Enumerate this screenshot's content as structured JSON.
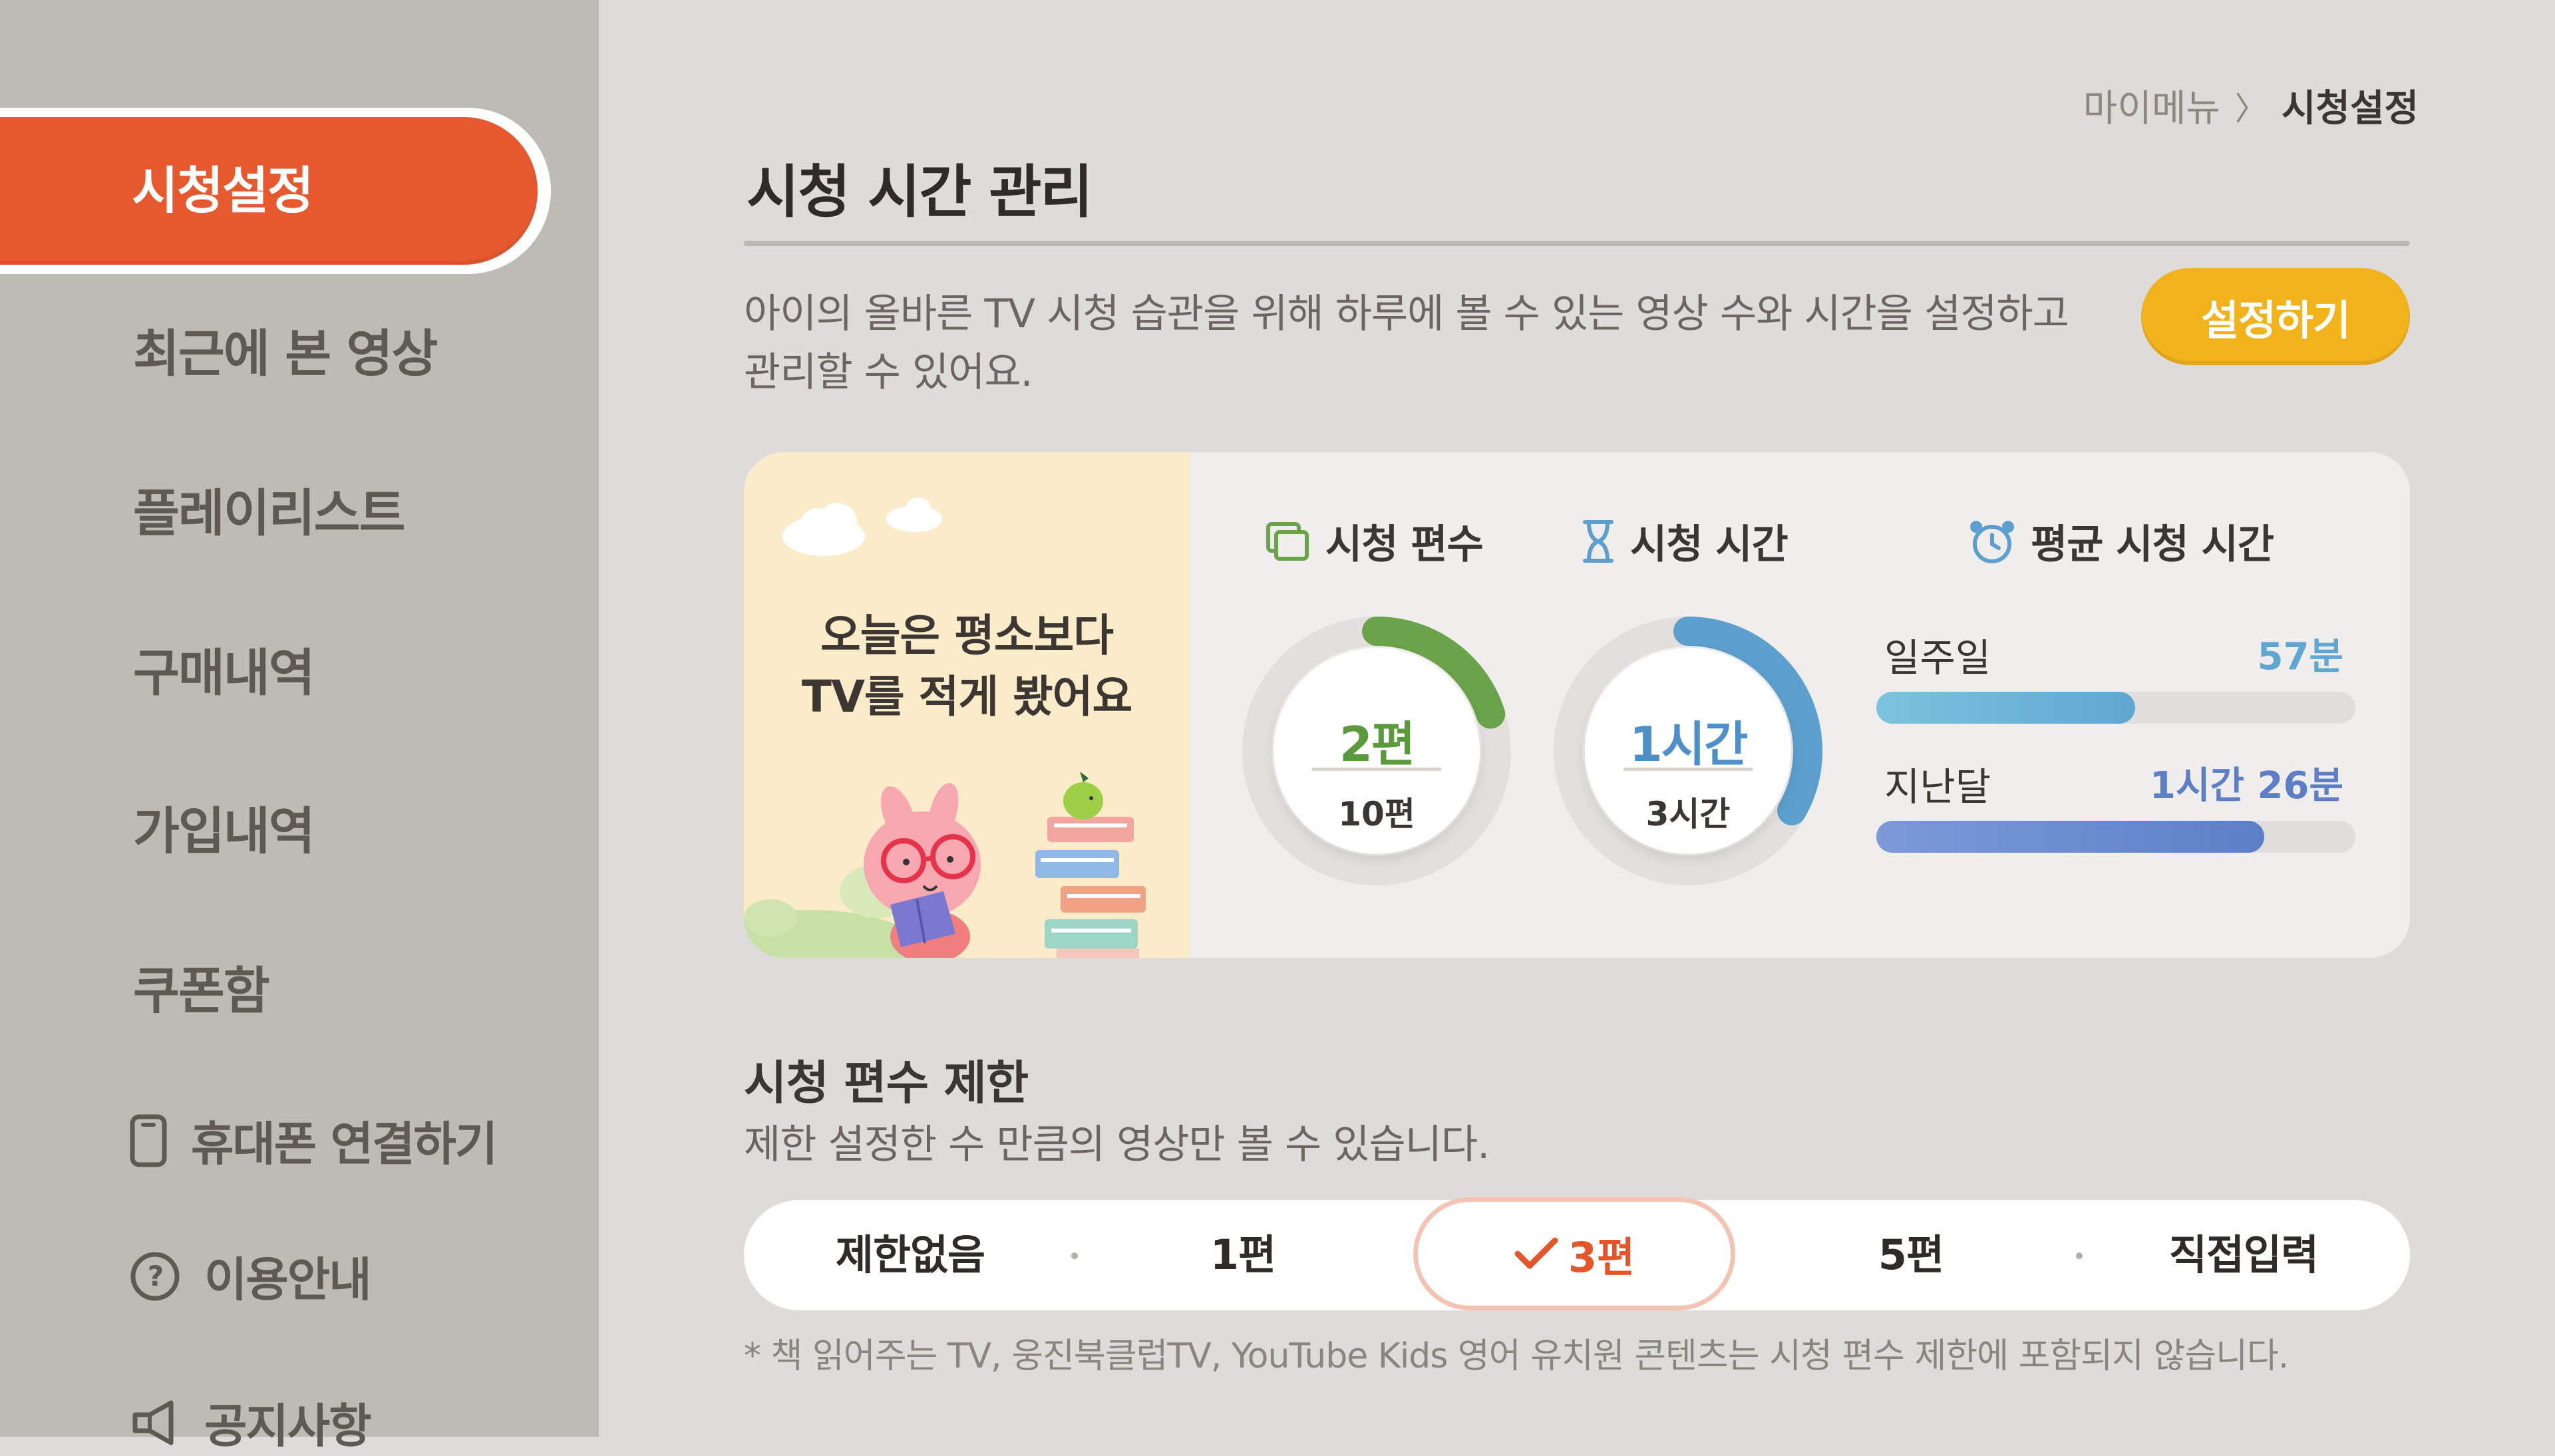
{
  "sidebar": {
    "items": [
      {
        "label": "시청설정",
        "active": true
      },
      {
        "label": "최근에 본 영상"
      },
      {
        "label": "플레이리스트"
      },
      {
        "label": "구매내역"
      },
      {
        "label": "가입내역"
      },
      {
        "label": "쿠폰함"
      }
    ],
    "sub_items": [
      {
        "label": "휴대폰 연결하기",
        "icon": "phone-icon"
      },
      {
        "label": "이용안내",
        "icon": "help-icon"
      },
      {
        "label": "공지사항",
        "icon": "megaphone-icon"
      }
    ]
  },
  "breadcrumb": {
    "parent": "마이메뉴",
    "separator": "〉",
    "current": "시청설정"
  },
  "header": {
    "title": "시청 시간 관리",
    "description_line1": "아이의 올바른 TV 시청 습관을 위해 하루에 볼 수 있는 영상 수와 시간을 설정하고",
    "description_line2": "관리할 수 있어요.",
    "setup_button": "설정하기"
  },
  "summary": {
    "message_line1": "오늘은 평소보다",
    "message_line2": "TV를 적게 봤어요",
    "episodes": {
      "label": "시청 편수",
      "icon": "episodes-icon",
      "watched": "2편",
      "limit": "10편",
      "progress": 0.2
    },
    "time": {
      "label": "시청 시간",
      "icon": "hourglass-icon",
      "watched": "1시간",
      "limit": "3시간",
      "progress": 0.333
    },
    "average": {
      "label": "평균 시청 시간",
      "icon": "alarm-clock-icon",
      "week_label": "일주일",
      "week_value": "57분",
      "week_fraction": 0.54,
      "month_label": "지난달",
      "month_value": "1시간 26분",
      "month_fraction": 0.81
    }
  },
  "limit": {
    "title": "시청 편수 제한",
    "description": "제한 설정한 수 만큼의 영상만 볼 수 있습니다.",
    "options": [
      "제한없음",
      "1편",
      "3편",
      "5편",
      "직접입력"
    ],
    "selected": "3편",
    "footnote": "* 책 읽어주는 TV, 웅진북클럽TV, YouTube Kids 영어 유치원 콘텐츠는 시청 편수 제한에 포함되지 않습니다."
  },
  "colors": {
    "accent": "#e6582e",
    "button": "#f2b21c",
    "episodes": "#6aa34a",
    "time": "#5c9fce",
    "bar_week": "#6fb6d8",
    "bar_month": "#6b8fcf"
  }
}
